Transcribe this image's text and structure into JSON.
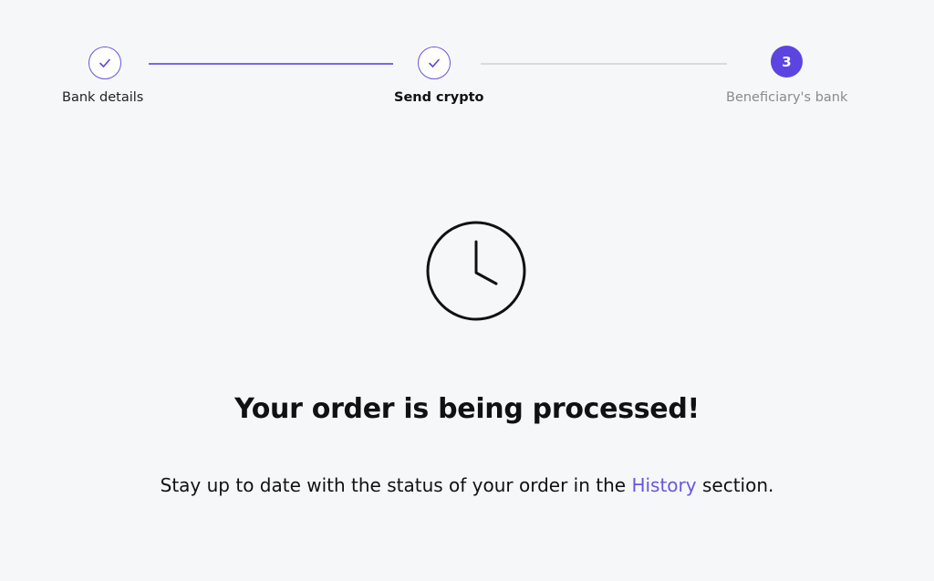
{
  "stepper": {
    "steps": [
      {
        "label": "Bank details",
        "state": "completed",
        "icon": "check-icon"
      },
      {
        "label": "Send crypto",
        "state": "completed",
        "icon": "check-icon"
      },
      {
        "label": "Beneficiary's bank",
        "state": "current",
        "number": "3"
      }
    ],
    "colors": {
      "accent": "#5b45e0",
      "completed_line": "#7a68e6",
      "pending_line": "#d9dae0"
    }
  },
  "status": {
    "icon": "clock-icon",
    "headline": "Your order is being processed!",
    "message_before": "Stay up to date with the status of your order in the ",
    "link_text": "History",
    "message_after": " section."
  }
}
